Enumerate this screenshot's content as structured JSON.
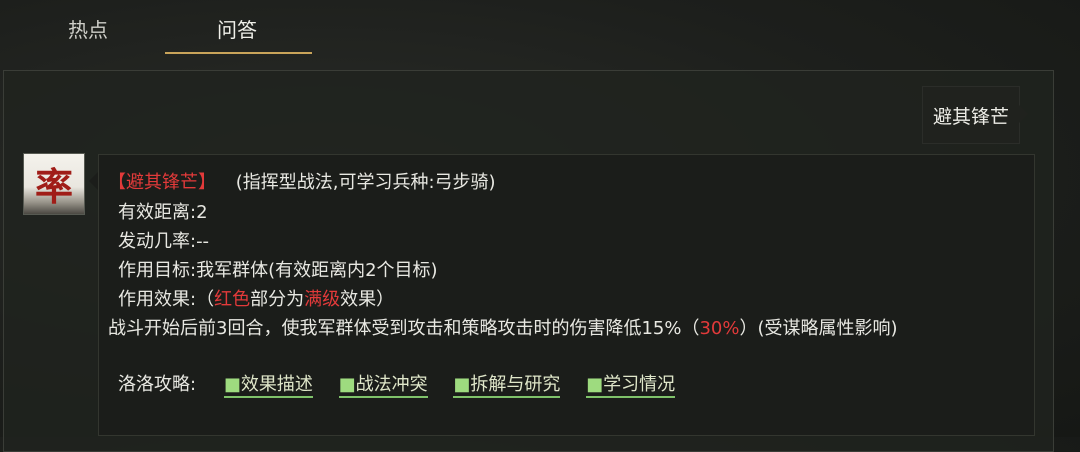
{
  "tabs": {
    "hot": "热点",
    "qa": "问答"
  },
  "question": "避其锋芒",
  "avatar": {
    "char": "率"
  },
  "answer": {
    "name_bracketed": "【避其锋芒】",
    "type_info": "(指挥型战法,可学习兵种:弓步骑)",
    "distance": "有效距离:2",
    "probability": "发动几率:--",
    "target": "作用目标:我军群体(有效距离内2个目标)",
    "effect_prefix": "作用效果:（",
    "effect_red": "红色",
    "effect_mid": "部分为",
    "effect_max": "满级",
    "effect_suffix": "效果）",
    "desc_prefix": "战斗开始后前3回合，使我军群体受到攻击和策略攻击时的伤害降低15%（",
    "desc_red": "30%",
    "desc_suffix": "）(受谋略属性影响)"
  },
  "guide": {
    "label": "洛洛攻略:",
    "bullet": "■",
    "links": [
      "效果描述",
      "战法冲突",
      "拆解与研究",
      "学习情况"
    ]
  },
  "colors": {
    "accent": "#c9a45a",
    "highlight_red": "#e23a3a",
    "link_underline": "#7fc26a"
  }
}
